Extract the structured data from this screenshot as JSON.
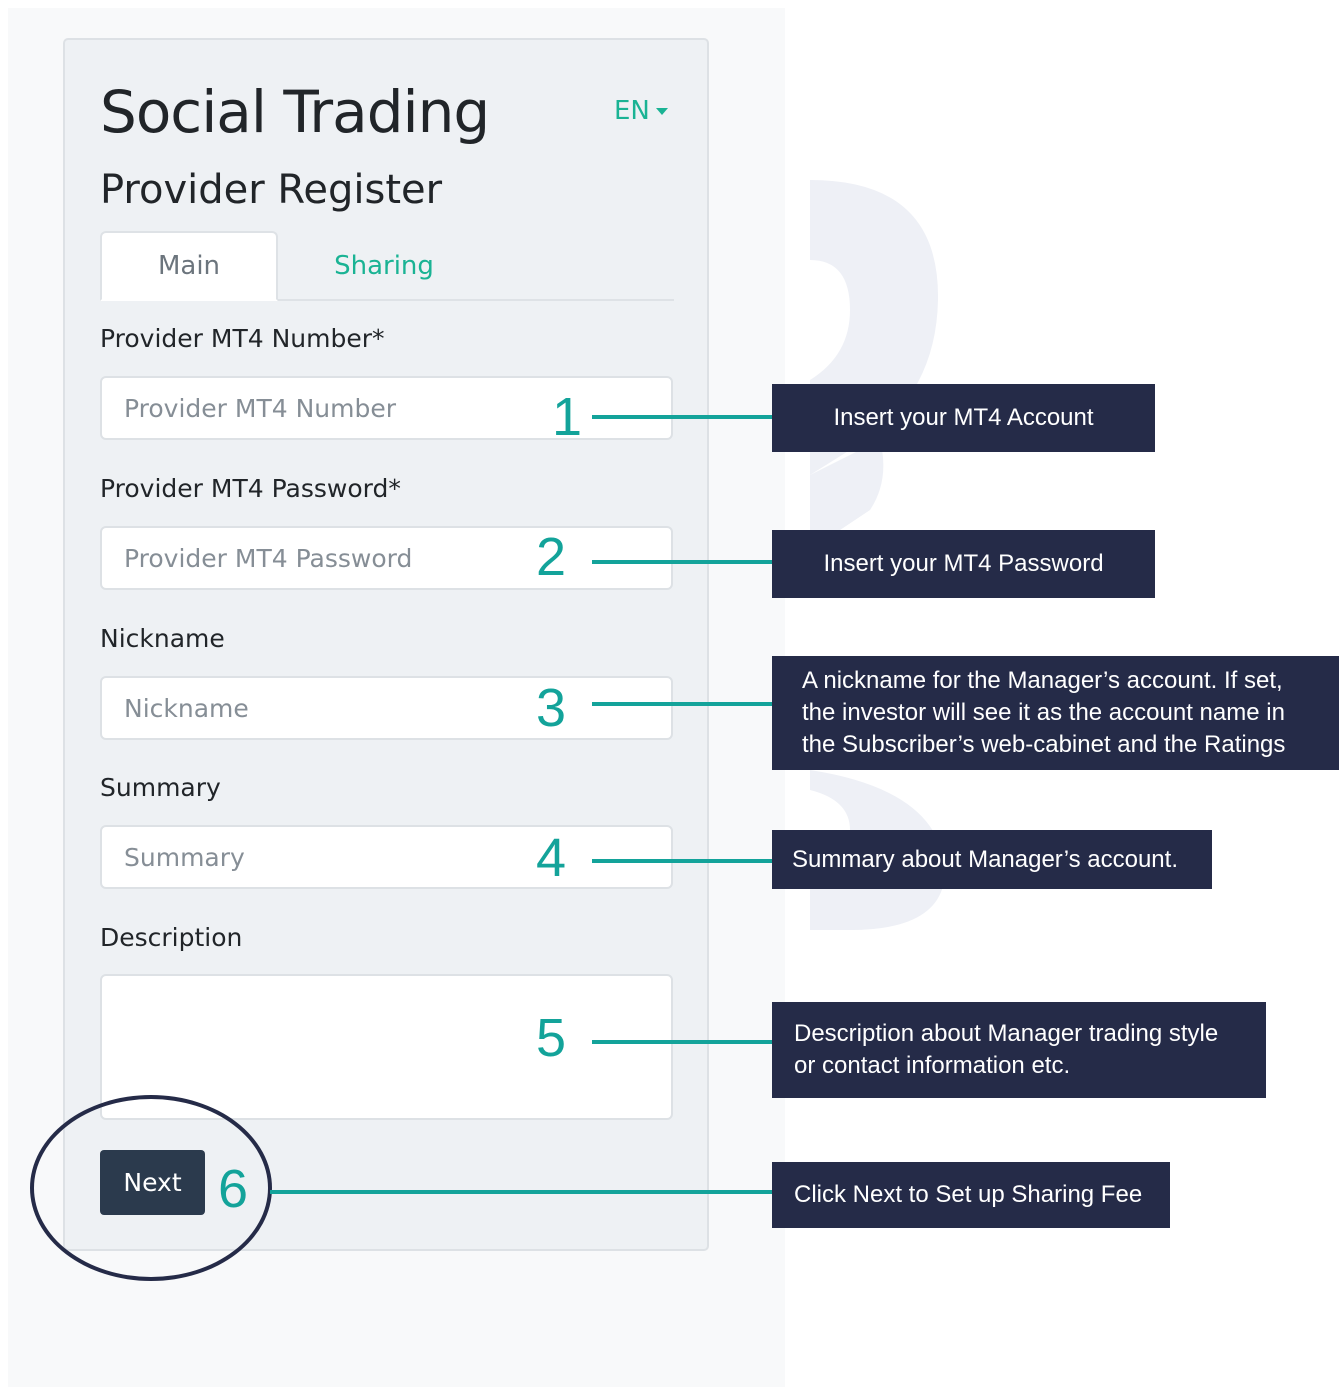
{
  "app": {
    "title": "Social Trading",
    "language": "EN",
    "subtitle": "Provider Register"
  },
  "tabs": [
    {
      "label": "Main",
      "active": true
    },
    {
      "label": "Sharing",
      "active": false
    }
  ],
  "form": {
    "mt4_number": {
      "label": "Provider MT4 Number*",
      "placeholder": "Provider MT4 Number",
      "value": ""
    },
    "mt4_password": {
      "label": "Provider MT4 Password*",
      "placeholder": "Provider MT4 Password",
      "value": ""
    },
    "nickname": {
      "label": "Nickname",
      "placeholder": "Nickname",
      "value": ""
    },
    "summary": {
      "label": "Summary",
      "placeholder": "Summary",
      "value": ""
    },
    "description": {
      "label": "Description",
      "placeholder": "",
      "value": ""
    },
    "next_label": "Next"
  },
  "annotations": [
    {
      "number": "1",
      "text": "Insert your MT4 Account"
    },
    {
      "number": "2",
      "text": "Insert your MT4 Password"
    },
    {
      "number": "3",
      "text": "A nickname for the Manager’s account. If set, the investor will see it as the account name in the Subscriber’s web-cabinet and the Ratings"
    },
    {
      "number": "4",
      "text": "Summary about Manager’s account."
    },
    {
      "number": "5",
      "text": "Description about Manager trading style or contact information etc."
    },
    {
      "number": "6",
      "text": "Click Next to Set up Sharing Fee"
    }
  ],
  "colors": {
    "accent": "#1ab394",
    "annotation_teal": "#13a39a",
    "callout_bg": "#252b48",
    "button_bg": "#2b3a4d",
    "card_bg": "#eef1f4"
  }
}
